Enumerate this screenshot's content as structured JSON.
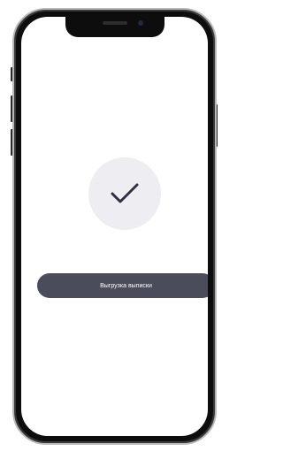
{
  "device": {
    "frame_color": "#0d0d0d",
    "screen_color": "#ffffff"
  },
  "success": {
    "icon": "checkmark-icon",
    "circle_color": "#eeeef2",
    "check_color": "#2f3140"
  },
  "actions": {
    "export_label": "Выгрузка выписки",
    "export_color": "#4a4c5c"
  }
}
